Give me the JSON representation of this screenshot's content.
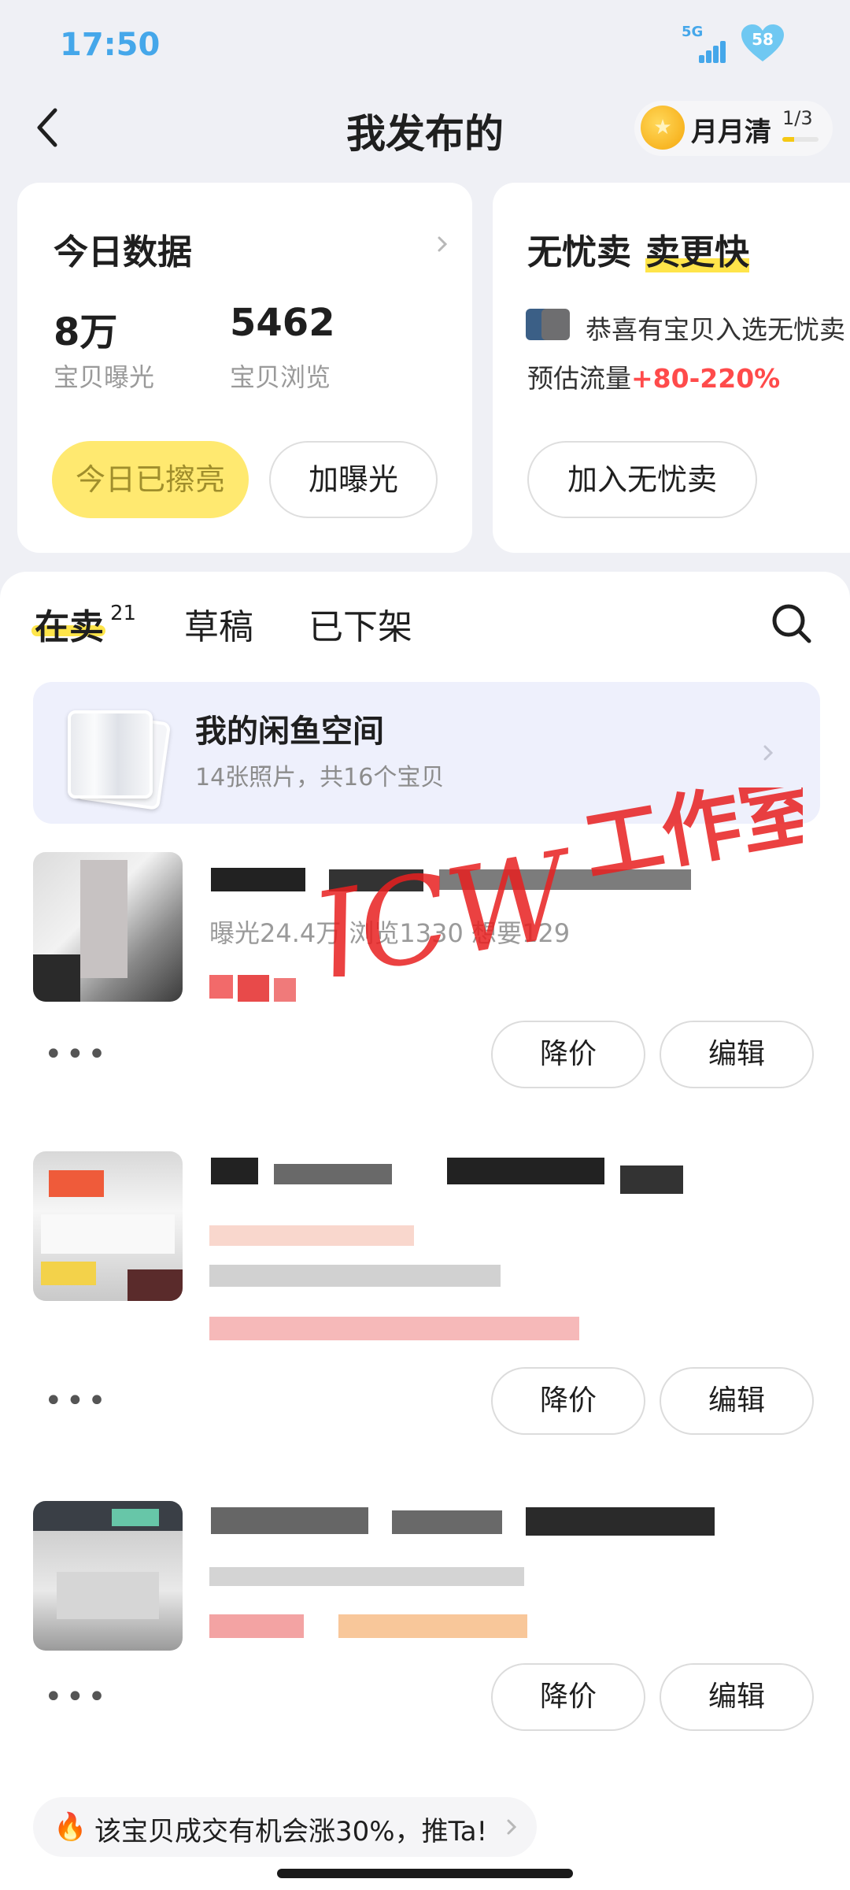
{
  "status_bar": {
    "time": "17:50",
    "network": "5G",
    "battery": "58"
  },
  "header": {
    "back_icon": "chevron-left-icon",
    "title": "我发布的",
    "monthly_label": "月月清",
    "monthly_progress": "1/3",
    "monthly_progress_fraction": 0.33
  },
  "today_card": {
    "title": "今日数据",
    "exposure_value": "8万",
    "exposure_label": "宝贝曝光",
    "views_value": "5462",
    "views_label": "宝贝浏览",
    "polished_button": "今日已擦亮",
    "boost_button": "加曝光"
  },
  "worry_free_card": {
    "title_part1": "无忧卖",
    "title_part2": "卖更快",
    "congrats_text": "恭喜有宝贝入选无忧卖",
    "traffic_label": "预估流量",
    "traffic_value": "+80-220%",
    "join_button": "加入无忧卖"
  },
  "tabs": [
    {
      "label": "在卖",
      "count": "21",
      "active": true
    },
    {
      "label": "草稿",
      "active": false
    },
    {
      "label": "已下架",
      "active": false
    }
  ],
  "space": {
    "title": "我的闲鱼空间",
    "subtitle": "14张照片，共16个宝贝"
  },
  "items": [
    {
      "meta": "曝光24.4万  浏览1330  想要129",
      "price_button": "降价",
      "edit_button": "编辑"
    },
    {
      "price_button": "降价",
      "edit_button": "编辑"
    },
    {
      "price_button": "降价",
      "edit_button": "编辑"
    }
  ],
  "tip": {
    "icon": "fire-icon",
    "text": "该宝贝成交有机会涨30%，推Ta!"
  },
  "watermark": "JCW工作室",
  "colors": {
    "accent_yellow": "#ffe54a",
    "promo_red": "#ff4b4b",
    "status_blue": "#45a7ea",
    "watermark_red": "#e82020"
  }
}
